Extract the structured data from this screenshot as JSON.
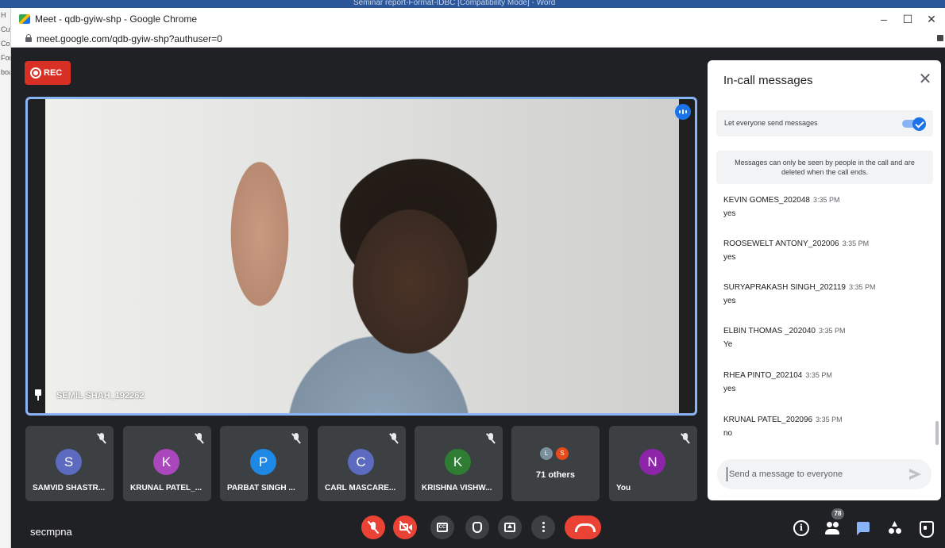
{
  "background_window": {
    "title": "Seminar report-Format-IDBC [Compatibility Mode] - Word",
    "sidebar_fragments": [
      "H",
      "Cut",
      "Cop",
      "Forn",
      "boar"
    ]
  },
  "window": {
    "title": "Meet - qdb-gyiw-shp - Google Chrome",
    "url": "meet.google.com/qdb-gyiw-shp?authuser=0",
    "controls": {
      "minimize": "–",
      "maximize": "☐",
      "close": "✕"
    }
  },
  "meet": {
    "rec_label": "REC",
    "main_participant": "SEMIL SHAH_192262",
    "meeting_code": "secmpna",
    "participant_count": "78",
    "tiles": [
      {
        "initial": "S",
        "name": "SAMVID SHASTR...",
        "color": "#5c6bc0"
      },
      {
        "initial": "K",
        "name": "KRUNAL PATEL_...",
        "color": "#ab47bc"
      },
      {
        "initial": "P",
        "name": "PARBAT SINGH ...",
        "color": "#1e88e5"
      },
      {
        "initial": "C",
        "name": "CARL MASCARE...",
        "color": "#5c6bc0"
      },
      {
        "initial": "K",
        "name": "KRISHNA VISHW...",
        "color": "#2e7d32"
      },
      {
        "others_label": "71 others",
        "mini": [
          {
            "initial": "L",
            "color": "#78909c"
          },
          {
            "initial": "S",
            "color": "#e64a19"
          }
        ]
      },
      {
        "initial": "N",
        "name": "You",
        "color": "#8e24aa"
      }
    ]
  },
  "chat": {
    "title": "In-call messages",
    "close_glyph": "✕",
    "permission_label": "Let everyone send messages",
    "permission_enabled": true,
    "notice": "Messages can only be seen by people in the call and are deleted when the call ends.",
    "messages": [
      {
        "sender": "KEVIN GOMES_202048",
        "time": "3:35 PM",
        "text": "yes"
      },
      {
        "sender": "ROOSEWELT ANTONY_202006",
        "time": "3:35 PM",
        "text": "yes"
      },
      {
        "sender": "SURYAPRAKASH SINGH_202119",
        "time": "3:35 PM",
        "text": "yes"
      },
      {
        "sender": "ELBIN THOMAS _202040",
        "time": "3:35 PM",
        "text": "Ye"
      },
      {
        "sender": "RHEA PINTO_202104",
        "time": "3:35 PM",
        "text": "yes"
      },
      {
        "sender": "KRUNAL PATEL_202096",
        "time": "3:35 PM",
        "text": "no"
      }
    ],
    "input_placeholder": "Send a message to everyone"
  },
  "icons": {
    "rec": "record-icon",
    "pin": "pin-icon",
    "speaking": "speaking-indicator-icon",
    "mic_off": "mic-off-icon",
    "cam_off": "camera-off-icon",
    "captions": "captions-icon",
    "hand": "raise-hand-icon",
    "present": "present-icon",
    "more": "more-options-icon",
    "end": "end-call-icon",
    "info": "info-icon",
    "people": "people-icon",
    "chat": "chat-icon",
    "activities": "activities-icon",
    "host": "host-controls-icon",
    "send": "send-icon"
  },
  "colors": {
    "meet_bg": "#202124",
    "tile_bg": "#3c4043",
    "danger": "#ea4335",
    "accent": "#1a73e8",
    "active_border": "#8ab4f8"
  }
}
